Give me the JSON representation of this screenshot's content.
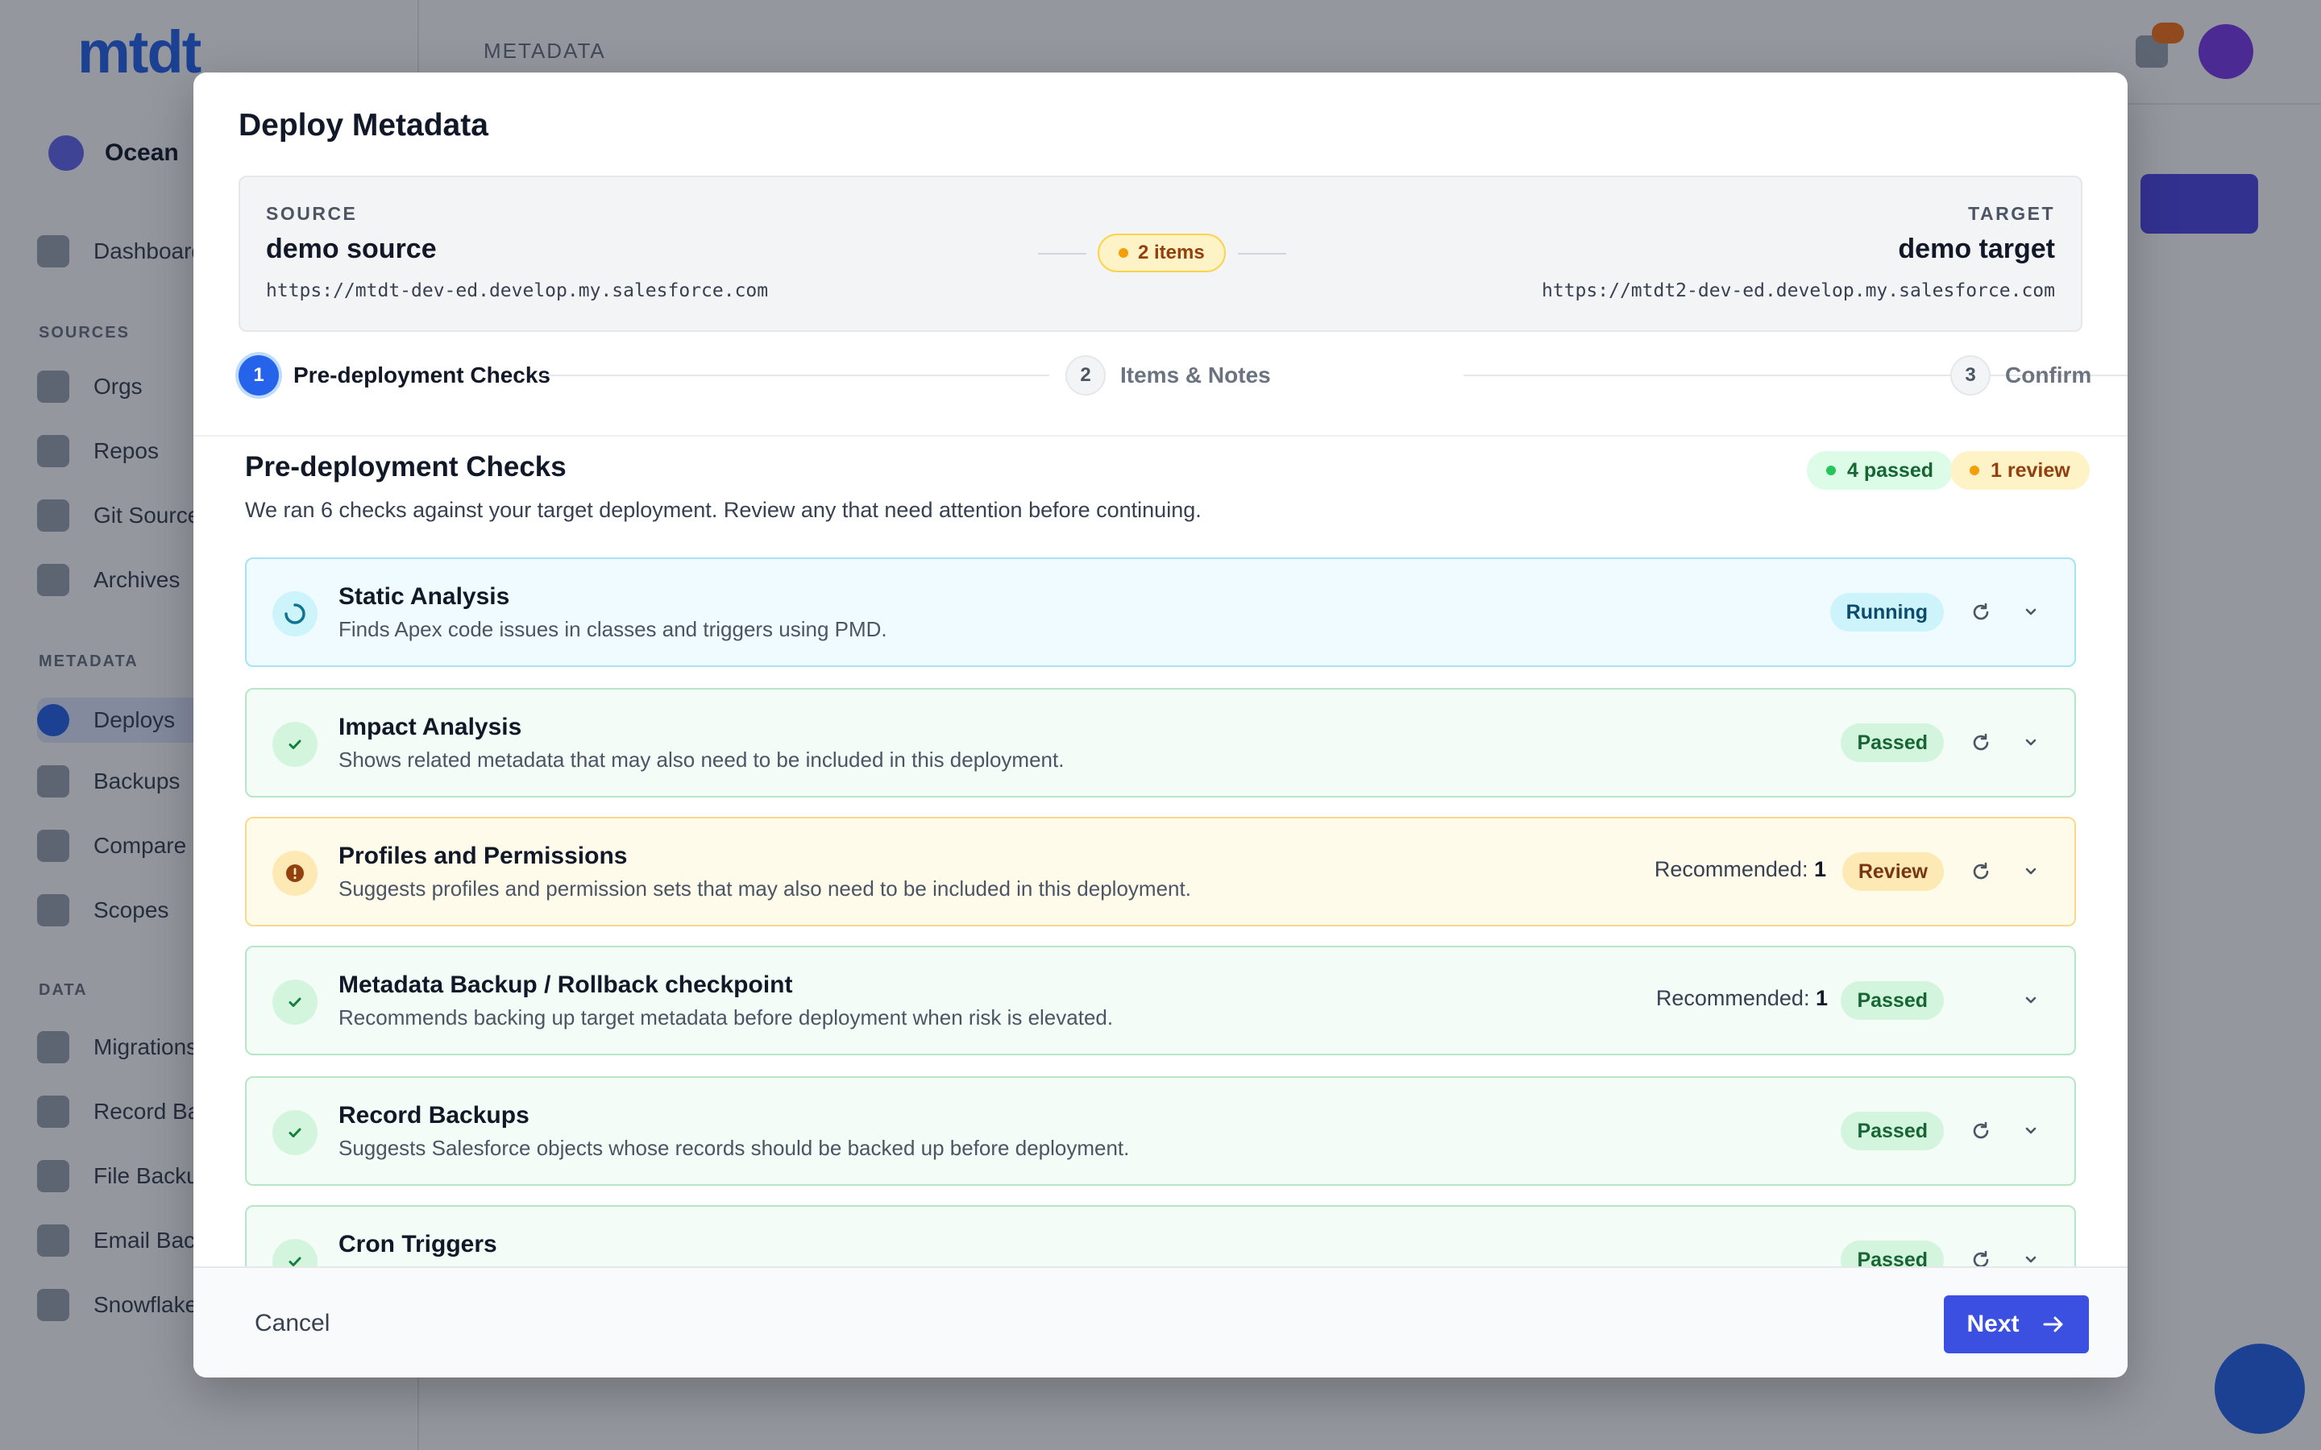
{
  "background": {
    "logo": "mtdt",
    "user_name": "Ocean",
    "breadcrumb": "METADATA",
    "sections": [
      "SOURCES",
      "METADATA",
      "DATA"
    ],
    "nav": [
      "Dashboard",
      "Orgs",
      "Repos",
      "Git Sources",
      "Archives",
      "Deploys",
      "Backups",
      "Compare",
      "Scopes",
      "Migrations",
      "Record Backups",
      "File Backups",
      "Email Backups",
      "Snowflake"
    ]
  },
  "modal": {
    "title": "Deploy Metadata",
    "source": {
      "label": "SOURCE",
      "name": "demo source",
      "url": "https://mtdt-dev-ed.develop.my.salesforce.com"
    },
    "target": {
      "label": "TARGET",
      "name": "demo target",
      "url": "https://mtdt2-dev-ed.develop.my.salesforce.com"
    },
    "items_count": "2 items",
    "steps": [
      {
        "num": "1",
        "label": "Pre-deployment Checks"
      },
      {
        "num": "2",
        "label": "Items & Notes"
      },
      {
        "num": "3",
        "label": "Confirm"
      }
    ],
    "section": {
      "title": "Pre-deployment Checks",
      "description": "We ran 6 checks against your target deployment. Review any that need attention before continuing.",
      "passed_badge": "4 passed",
      "review_badge": "1 review"
    },
    "checks": [
      {
        "title": "Static Analysis",
        "description": "Finds Apex code issues in classes and triggers using PMD.",
        "status": "Running",
        "recommended": ""
      },
      {
        "title": "Impact Analysis",
        "description": "Shows related metadata that may also need to be included in this deployment.",
        "status": "Passed",
        "recommended": ""
      },
      {
        "title": "Profiles and Permissions",
        "description": "Suggests profiles and permission sets that may also need to be included in this deployment.",
        "status": "Review",
        "recommended_label": "Recommended:",
        "recommended_count": "1"
      },
      {
        "title": "Metadata Backup / Rollback checkpoint",
        "description": "Recommends backing up target metadata before deployment when risk is elevated.",
        "status": "Passed",
        "recommended_label": "Recommended:",
        "recommended_count": "1"
      },
      {
        "title": "Record Backups",
        "description": "Suggests Salesforce objects whose records should be backed up before deployment.",
        "status": "Passed",
        "recommended": ""
      },
      {
        "title": "Cron Triggers",
        "description": "",
        "status": "Passed",
        "recommended": ""
      }
    ],
    "footer": {
      "cancel_label": "Cancel",
      "next_label": "Next"
    }
  },
  "colors": {
    "primary": "#3b4fe0",
    "passed": "#166534",
    "review": "#92400e",
    "running": "#0c4a6e"
  }
}
